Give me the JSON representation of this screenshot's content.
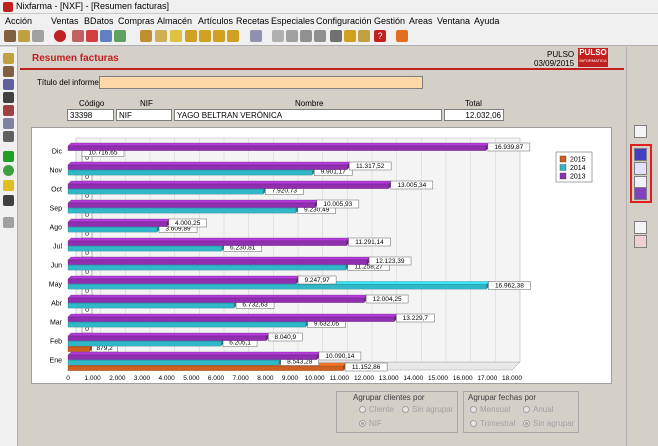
{
  "window": {
    "title": "Nixfarma - [NXF] - [Resumen facturas]"
  },
  "menu": [
    "Acción",
    "Ventas",
    "BDatos",
    "Compras",
    "Almacén",
    "Artículos",
    "Recetas",
    "Especiales",
    "Configuración",
    "Gestión",
    "Areas",
    "Ventana",
    "Ayuda"
  ],
  "header": {
    "title": "Resumen facturas",
    "company": "PULSO",
    "date": "03/09/2015",
    "logo_text": "PULSO",
    "logo_sub": "INFORMATICA"
  },
  "form": {
    "titulo_label": "Título del informe",
    "titulo_value": "",
    "col_codigo": "Código",
    "col_nif": "NIF",
    "col_nombre": "Nombre",
    "col_total": "Total",
    "codigo": "33398",
    "nif": "NIF",
    "nombre": "YAGO BELTRAN VERÓNICA",
    "total": "12.032,06"
  },
  "grouping": {
    "clientes_title": "Agrupar clientes por",
    "clientes_opt1": "Cliente",
    "clientes_opt2": "Sin agrupar",
    "clientes_opt3": "NIF",
    "fechas_title": "Agrupar fechas por",
    "fechas_opt1": "Mensual",
    "fechas_opt2": "Anual",
    "fechas_opt3": "Trimestral",
    "fechas_opt4": "Sin agrupar"
  },
  "colors": {
    "s2015": "#d06020",
    "s2014": "#30b8c8",
    "s2013": "#9030b0",
    "accent": "#c02020",
    "field_yellow": "#ffd8a8"
  },
  "chart_data": {
    "type": "bar",
    "orientation": "horizontal",
    "categories": [
      "Ene",
      "Feb",
      "Mar",
      "Abr",
      "May",
      "Jun",
      "Jul",
      "Ago",
      "Sep",
      "Oct",
      "Nov",
      "Dic"
    ],
    "series": [
      {
        "name": "2015",
        "values": [
          11152.86,
          879.2,
          0,
          0,
          0,
          0,
          0,
          0,
          0,
          0,
          0,
          0
        ]
      },
      {
        "name": "2014",
        "values": [
          8543.28,
          6205.1,
          9632.05,
          6732.63,
          16962.38,
          11258.27,
          6230.81,
          3609.89,
          9230.49,
          7920.73,
          9901.17,
          0
        ]
      },
      {
        "name": "2013",
        "values": [
          10090.14,
          8040.9,
          13229.7,
          12004.25,
          9247.97,
          12123.39,
          11291.14,
          4000.25,
          10005.93,
          13005.34,
          11317.52,
          16939.87
        ]
      }
    ],
    "labels": {
      "Ene": [
        "11.152,86",
        "8.543,28",
        "10.090,14"
      ],
      "Feb": [
        "879,2",
        "6.205,1",
        "8.040,9"
      ],
      "Mar": [
        "0",
        "9.632,05",
        "13.229,7"
      ],
      "Abr": [
        "0",
        "6.732,63",
        "12.004,25"
      ],
      "May": [
        "0",
        "16.962,38",
        "9.247,97"
      ],
      "Jun": [
        "0",
        "11.258,27",
        "12.123,39"
      ],
      "Jul": [
        "0",
        "6.230,81",
        "11.291,14"
      ],
      "Ago": [
        "0",
        "3.609,89",
        "4.000,25"
      ],
      "Sep": [
        "0",
        "9.230,49",
        "10.005,93"
      ],
      "Oct": [
        "0",
        "7.920,73",
        "13.005,34"
      ],
      "Nov": [
        "0",
        "9.901,17",
        "11.317,52"
      ],
      "Dic": [
        "0",
        "10.716,65",
        "16.939,87"
      ]
    },
    "xlim": [
      0,
      18000
    ],
    "xticks": [
      "0",
      "1.000",
      "2.000",
      "3.000",
      "4.000",
      "5.000",
      "6.000",
      "7.000",
      "8.000",
      "9.000",
      "10.000",
      "11.000",
      "12.000",
      "13.000",
      "14.000",
      "15.000",
      "16.000",
      "17.000",
      "18.000"
    ],
    "legend_position": "right"
  }
}
